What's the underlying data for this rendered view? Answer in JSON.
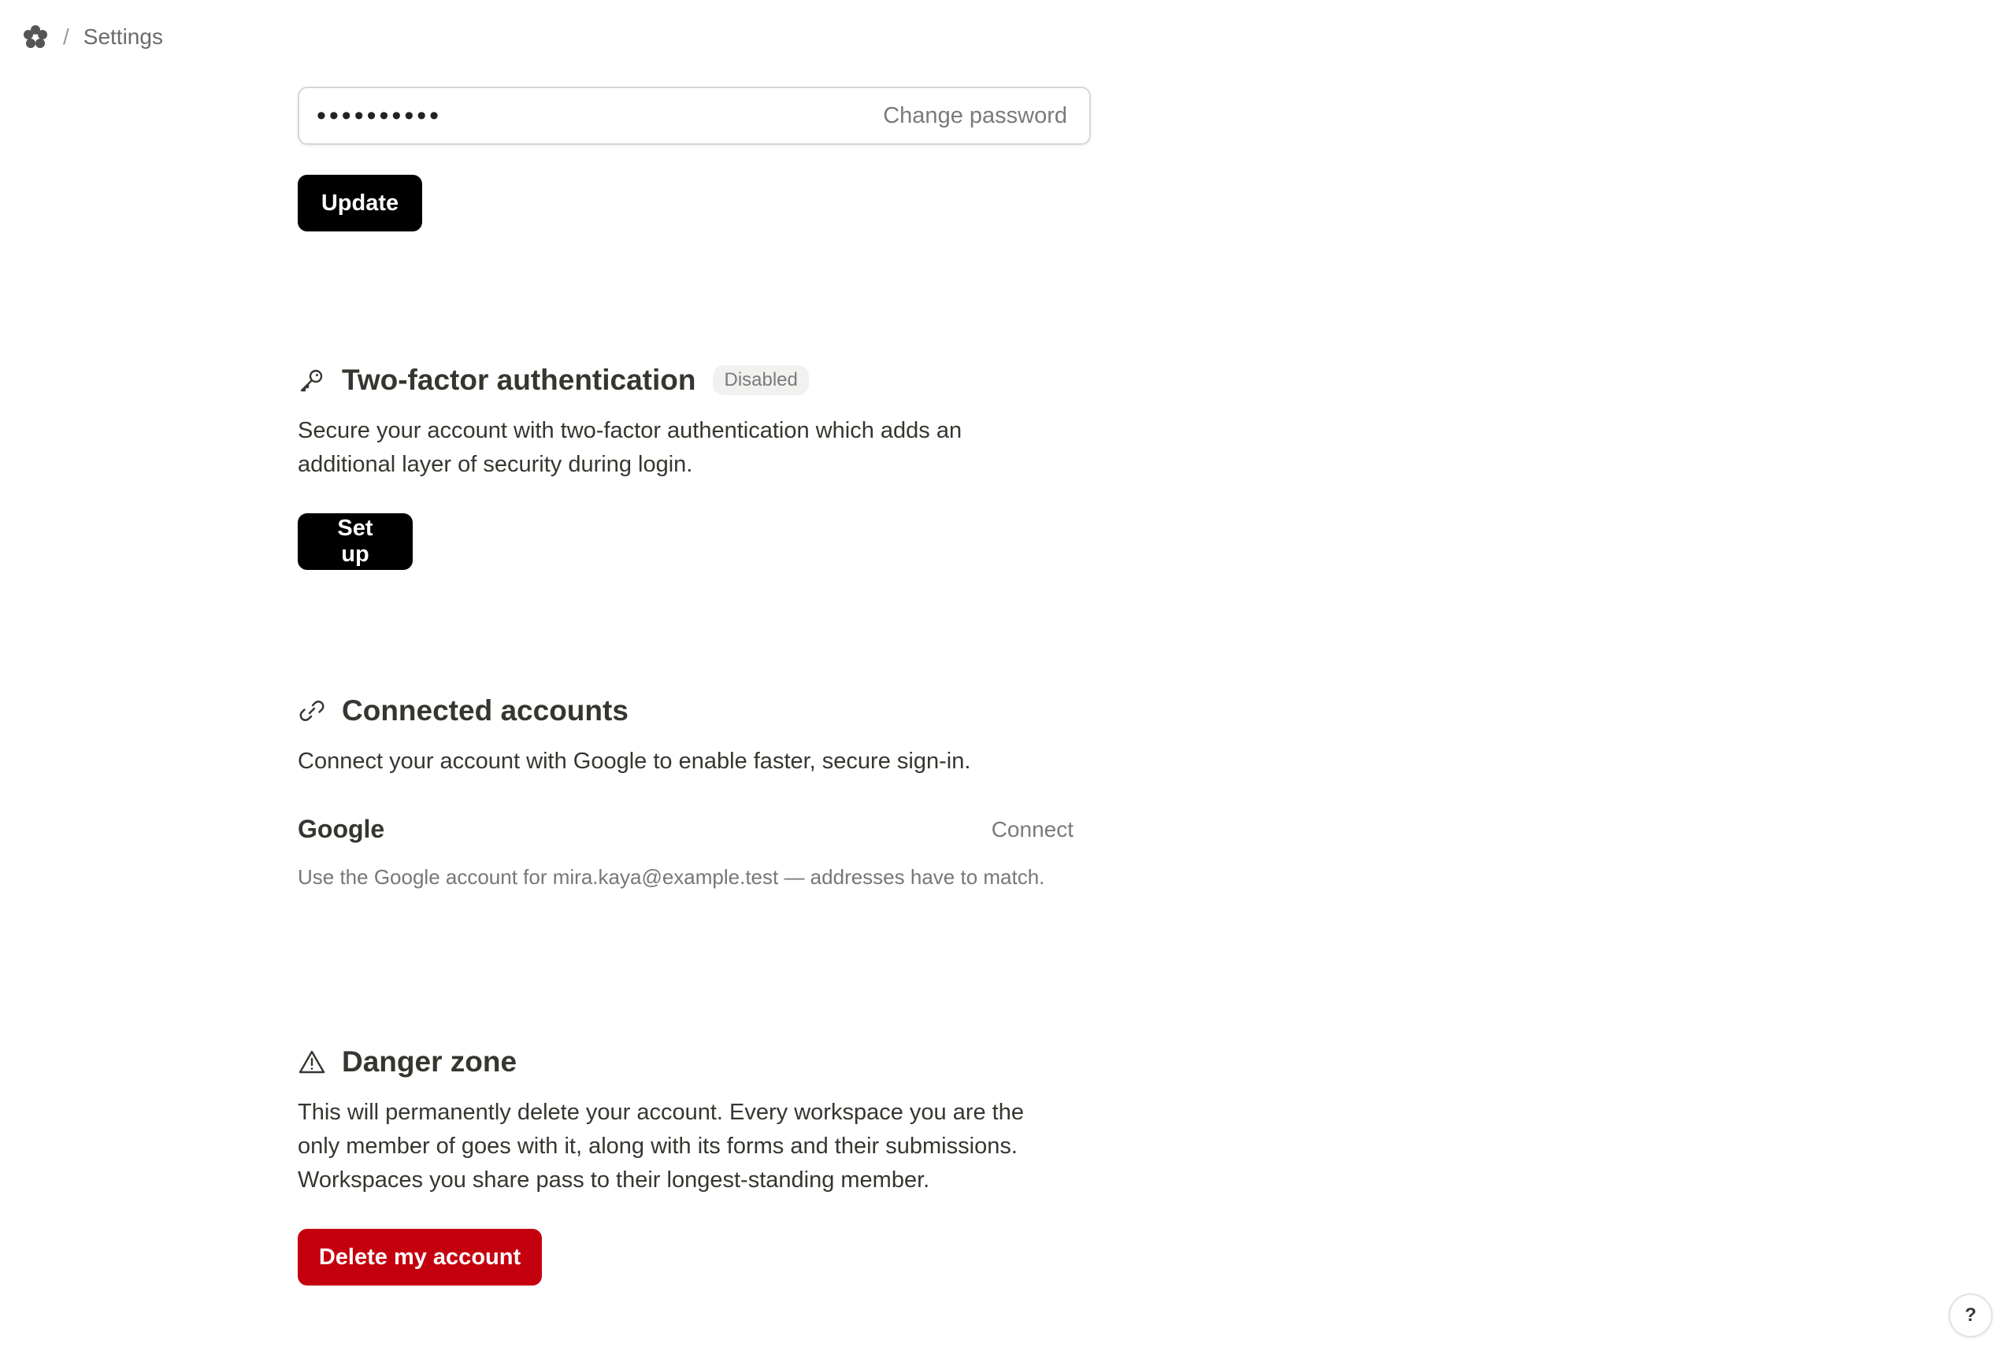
{
  "breadcrumb": {
    "logo_icon": "flower-logo-icon",
    "separator": "/",
    "current": "Settings"
  },
  "password": {
    "value": "••••••••••",
    "change_label": "Change password",
    "update_label": "Update"
  },
  "two_factor": {
    "icon": "key-icon",
    "title": "Two-factor authentication",
    "status": "Disabled",
    "description": "Secure your account with two-factor authentication which adds an additional layer of security during login.",
    "setup_label": "Set up"
  },
  "connected": {
    "icon": "link-icon",
    "title": "Connected accounts",
    "description": "Connect your account with Google to enable faster, secure sign-in.",
    "provider": {
      "name": "Google",
      "action_label": "Connect",
      "note": "Use the Google account for mira.kaya@example.test — addresses have to match."
    }
  },
  "danger": {
    "icon": "warning-icon",
    "title": "Danger zone",
    "description": "This will permanently delete your account. Every workspace you are the only member of goes with it, along with its forms and their submissions. Workspaces you share pass to their longest-standing member.",
    "delete_label": "Delete my account",
    "accent": "#c4000f"
  },
  "help": {
    "label": "?"
  }
}
